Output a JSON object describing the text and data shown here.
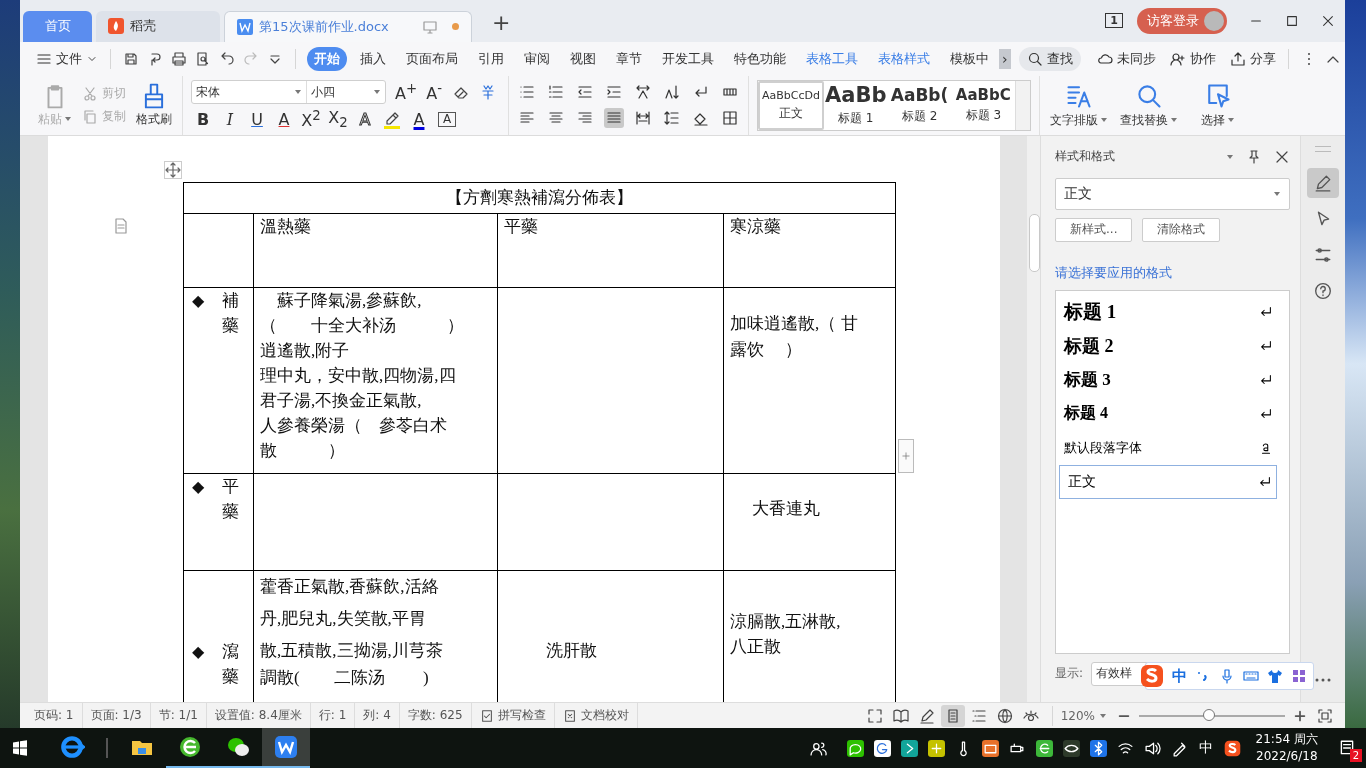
{
  "doc_tabs": [
    {
      "label": "首页",
      "kind": "home",
      "selected": false,
      "modified": false
    },
    {
      "label": "稻壳",
      "kind": "docer",
      "selected": false,
      "modified": false
    },
    {
      "label": "第15次课前作业.docx",
      "kind": "doc",
      "selected": true,
      "modified": true
    }
  ],
  "new_tab": "+",
  "title_bar": {
    "window_count": "1",
    "login": "访客登录"
  },
  "file_menu": "文件",
  "menu_tabs": [
    {
      "label": "开始",
      "kind": "main",
      "selected": true
    },
    {
      "label": "插入",
      "kind": "main",
      "selected": false
    },
    {
      "label": "页面布局",
      "kind": "main",
      "selected": false
    },
    {
      "label": "引用",
      "kind": "main",
      "selected": false
    },
    {
      "label": "审阅",
      "kind": "main",
      "selected": false
    },
    {
      "label": "视图",
      "kind": "main",
      "selected": false
    },
    {
      "label": "章节",
      "kind": "main",
      "selected": false
    },
    {
      "label": "开发工具",
      "kind": "main",
      "selected": false
    },
    {
      "label": "特色功能",
      "kind": "main",
      "selected": false
    },
    {
      "label": "表格工具",
      "kind": "table",
      "selected": false
    },
    {
      "label": "表格样式",
      "kind": "table",
      "selected": false
    },
    {
      "label": "模板中",
      "kind": "main",
      "selected": false
    }
  ],
  "more_tabs": "›",
  "search": "查找",
  "sync": "未同步",
  "collaborate": "协作",
  "share": "分享",
  "clipboard": [
    {
      "label": "粘贴",
      "kind": "paste",
      "disabled": true
    },
    {
      "label": "剪切",
      "kind": "cut",
      "disabled": true
    },
    {
      "label": "复制",
      "kind": "copy",
      "disabled": true
    },
    {
      "label": "格式刷",
      "kind": "brush",
      "disabled": false
    }
  ],
  "font": {
    "name": "宋体",
    "size": "小四"
  },
  "glyphs": {
    "grow": "A$^{+}$",
    "shrink": "A$^{-}$",
    "bold": "B",
    "italic": "I",
    "underline": "U",
    "strike": "A",
    "superscript": "X$^{2}$",
    "subscript": "X$_{2}$",
    "effect": "A",
    "font_color": "A",
    "border": "A"
  },
  "gallery": [
    {
      "preview": "AaBbCcDd",
      "label": "正文",
      "selected": true
    },
    {
      "preview": "AaBb",
      "label": "标题 1",
      "selected": false
    },
    {
      "preview": "AaBb(",
      "label": "标题 2",
      "selected": false
    },
    {
      "preview": "AaBbC",
      "label": "标题 3",
      "selected": false
    }
  ],
  "ribbon_tools": [
    {
      "label": "文字排版",
      "kind": "layout"
    },
    {
      "label": "查找替换",
      "kind": "find"
    },
    {
      "label": "选择",
      "kind": "select"
    }
  ],
  "table": {
    "title": "【方劑寒熱補瀉分佈表】",
    "columns": [
      "溫熱藥",
      "平藥",
      "寒涼藥"
    ],
    "rows": [
      {
        "marker": "◆",
        "label": "補藥",
        "cells": [
          [
            "　蘇子降氣湯,參蘇飲,",
            "（　　十全大补汤　　　）",
            "逍遙散,附子",
            "理中丸，安中散,四物湯,四",
            "君子湯,不換金正氣散,",
            "人參養榮湯（　參苓白术",
            "散　　　）"
          ],
          [],
          [
            "加味逍遙散,（ 甘",
            "露饮　 ）"
          ]
        ]
      },
      {
        "marker": "◆",
        "label": "平藥",
        "cells": [
          [],
          [],
          [
            "大香連丸"
          ]
        ]
      },
      {
        "marker": "◆",
        "label": "瀉藥",
        "cells": [
          [
            "藿香正氣散,香蘇飲,活絡",
            "丹,肥兒丸,失笑散,平胃",
            "散,五積散,三拗湯,川芎茶",
            "調散(　　二陈汤　　 )"
          ],
          [
            "洗肝散"
          ],
          [
            "涼膈散,五淋散,",
            "八正散"
          ]
        ]
      }
    ]
  },
  "styles_panel": {
    "title": "样式和格式",
    "current": "正文",
    "buttons": [
      "新样式...",
      "清除格式"
    ],
    "prompt": "请选择要应用的格式",
    "items": [
      {
        "label": "标题 1",
        "kind": "h1",
        "selected": false
      },
      {
        "label": "标题 2",
        "kind": "h2",
        "selected": false
      },
      {
        "label": "标题 3",
        "kind": "h3",
        "selected": false
      },
      {
        "label": "标题 4",
        "kind": "h4",
        "selected": false
      },
      {
        "label": "默认段落字体",
        "kind": "char",
        "selected": false
      },
      {
        "label": "正文",
        "kind": "body",
        "selected": true
      }
    ],
    "show_label": "显示:",
    "show_value": "有效样"
  },
  "ime": {
    "mode": "中"
  },
  "side_tools": [
    {
      "kind": "pen",
      "selected": true
    },
    {
      "kind": "pointer",
      "selected": false
    },
    {
      "kind": "sliders",
      "selected": false
    },
    {
      "kind": "help",
      "selected": false
    }
  ],
  "status": {
    "items": [
      "页码: 1",
      "页面: 1/3",
      "节: 1/1",
      "设置值: 8.4厘米",
      "行: 1",
      "列: 4",
      "字数: 625"
    ],
    "checks": [
      {
        "label": "拼写检查",
        "kind": "check"
      },
      {
        "label": "文档校对",
        "kind": "proof"
      }
    ],
    "views": [
      {
        "kind": "fullscreen",
        "selected": false
      },
      {
        "kind": "reading",
        "selected": false
      },
      {
        "kind": "edit",
        "selected": false
      },
      {
        "kind": "page",
        "selected": true
      },
      {
        "kind": "outline",
        "selected": false
      },
      {
        "kind": "web",
        "selected": false
      },
      {
        "kind": "eye",
        "selected": false
      }
    ],
    "zoom": "120%",
    "zoom_slider": {
      "level": 0.48
    }
  },
  "taskbar": {
    "apps": [
      {
        "kind": "ie",
        "active": false
      },
      {
        "kind": "folder",
        "active": false
      },
      {
        "kind": "browser",
        "active": false
      },
      {
        "kind": "chat",
        "active": false
      },
      {
        "kind": "wps",
        "active": true
      }
    ],
    "ime": "中",
    "time": "21:54 周六",
    "date": "2022/6/18",
    "notifications": "2"
  }
}
